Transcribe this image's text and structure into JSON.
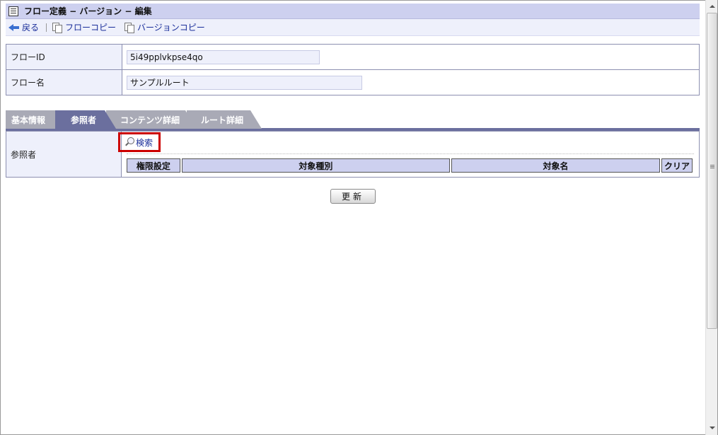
{
  "titlebar": {
    "title": "フロー定義 − バージョン − 編集"
  },
  "toolbar": {
    "back_label": "戻る",
    "flow_copy_label": "フローコピー",
    "version_copy_label": "バージョンコピー"
  },
  "form": {
    "flow_id_label": "フローID",
    "flow_id_value": "5i49pplvkpse4qo",
    "flow_name_label": "フロー名",
    "flow_name_value": "サンプルルート"
  },
  "tabs": [
    {
      "label": "基本情報"
    },
    {
      "label": "参照者"
    },
    {
      "label": "コンテンツ詳細"
    },
    {
      "label": "ルート詳細"
    }
  ],
  "active_tab": "参照者",
  "referrer": {
    "label": "参照者",
    "search_label": "検索",
    "columns": [
      "権限設定",
      "対象種別",
      "対象名",
      "クリア"
    ]
  },
  "actions": {
    "update_label": "更新"
  },
  "colors": {
    "header_bg": "#cdd0ef",
    "tab_active": "#6b6f9e",
    "tab_inactive": "#a9aab6",
    "highlight": "#cc0000"
  }
}
